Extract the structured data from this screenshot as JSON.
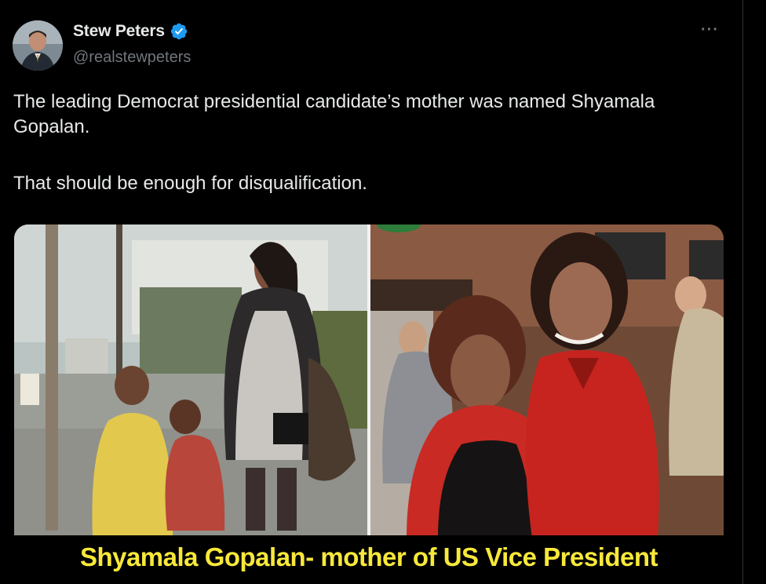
{
  "author": {
    "display_name": "Stew Peters",
    "handle": "@realstewpeters",
    "verified_icon": "verified-badge-icon",
    "avatar_icon": "avatar"
  },
  "menu": {
    "more_label": "···"
  },
  "tweet": {
    "paragraphs": [
      "The leading Democrat presidential candidate’s mother was named Shyamala Gopalan.",
      "That should be enough for disqualification."
    ]
  },
  "media": {
    "caption": "Shyamala Gopalan- mother of US Vice President"
  },
  "colors": {
    "background": "#000000",
    "text": "#e7e9ea",
    "secondary_text": "#71767b",
    "verified": "#1d9bf0",
    "caption": "#f7e83a"
  }
}
